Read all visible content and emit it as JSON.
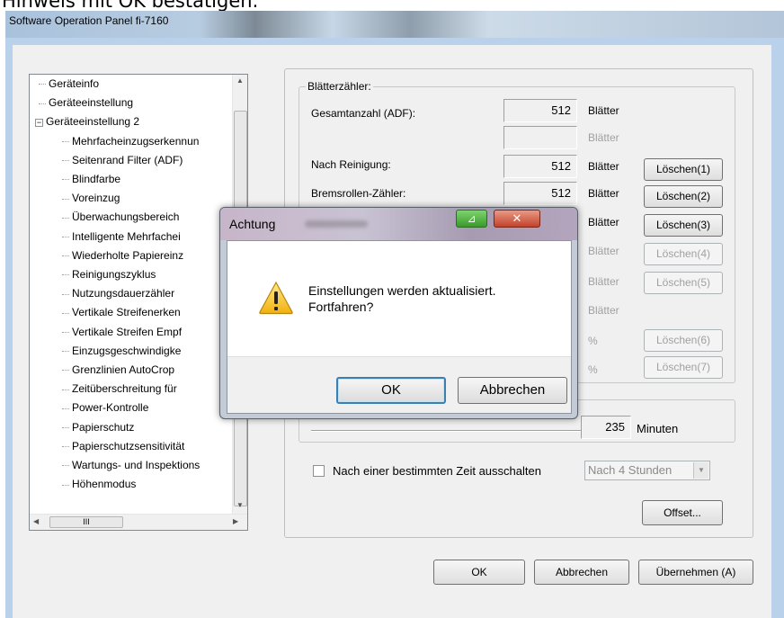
{
  "caption": "Hinweis mit OK bestätigen.",
  "window": {
    "title": "Software Operation Panel fi-7160"
  },
  "tree": {
    "items": [
      {
        "label": "Geräteinfo",
        "level": 1
      },
      {
        "label": "Geräteeinstellung",
        "level": 1
      },
      {
        "label": "Geräteeinstellung 2",
        "level": 0
      },
      {
        "label": "Mehrfacheinzugserkennun",
        "level": 2
      },
      {
        "label": "Seitenrand Filter (ADF)",
        "level": 2
      },
      {
        "label": "Blindfarbe",
        "level": 2
      },
      {
        "label": "Voreinzug",
        "level": 2
      },
      {
        "label": "Überwachungsbereich",
        "level": 2
      },
      {
        "label": "Intelligente Mehrfachei",
        "level": 2
      },
      {
        "label": "Wiederholte Papiereinz",
        "level": 2
      },
      {
        "label": "Reinigungszyklus",
        "level": 2
      },
      {
        "label": "Nutzungsdauerzähler",
        "level": 2
      },
      {
        "label": "Vertikale Streifenerken",
        "level": 2
      },
      {
        "label": "Vertikale Streifen Empf",
        "level": 2
      },
      {
        "label": "Einzugsgeschwindigke",
        "level": 2
      },
      {
        "label": "Grenzlinien AutoCrop",
        "level": 2
      },
      {
        "label": "Zeitüberschreitung für",
        "level": 2
      },
      {
        "label": "Power-Kontrolle",
        "level": 2
      },
      {
        "label": "Papierschutz",
        "level": 2
      },
      {
        "label": "Papierschutzsensitivität",
        "level": 2
      },
      {
        "label": "Wartungs- und Inspektions",
        "level": 2
      },
      {
        "label": "Höhenmodus",
        "level": 2
      }
    ],
    "expander": "−",
    "hscroll_grip": "III",
    "scroll_left": "◀",
    "scroll_right": "▶",
    "scroll_up": "▲",
    "scroll_down": "▼"
  },
  "counter": {
    "group_label": "Blätterzähler:",
    "rows": [
      {
        "label": "Gesamtanzahl (ADF):",
        "value": "512",
        "unit": "Blätter",
        "button": "",
        "enabled": true
      },
      {
        "label": "",
        "value": "",
        "unit": "Blätter",
        "button": "",
        "enabled": false
      },
      {
        "label": "Nach Reinigung:",
        "value": "512",
        "unit": "Blätter",
        "button": "Löschen(1)",
        "enabled": true
      },
      {
        "label": "Bremsrollen-Zähler:",
        "value": "512",
        "unit": "Blätter",
        "button": "Löschen(2)",
        "enabled": true
      },
      {
        "label": "",
        "value": "",
        "unit": "Blätter",
        "button": "Löschen(3)",
        "enabled": true
      },
      {
        "label": "",
        "value": "",
        "unit": "Blätter",
        "button": "Löschen(4)",
        "enabled": false
      },
      {
        "label": "",
        "value": "",
        "unit": "Blätter",
        "button": "Löschen(5)",
        "enabled": false
      },
      {
        "label": "",
        "value": "",
        "unit": "Blätter",
        "button": "",
        "enabled": false
      },
      {
        "label": "",
        "value": "",
        "unit": "%",
        "button": "Löschen(6)",
        "enabled": false
      },
      {
        "label": "",
        "value": "",
        "unit": "%",
        "button": "Löschen(7)",
        "enabled": false
      }
    ]
  },
  "power": {
    "minutes_value": "235",
    "minutes_unit": "Minuten",
    "checkbox_label": "Nach einer bestimmten Zeit ausschalten",
    "checked": false,
    "combo_value": "Nach 4 Stunden",
    "offset_button": "Offset..."
  },
  "footer": {
    "ok": "OK",
    "cancel": "Abbrechen",
    "apply": "Übernehmen (A)"
  },
  "dialog": {
    "title": "Achtung",
    "minimize_glyph": "⊿",
    "close_glyph": "✕",
    "message_line1": "Einstellungen werden aktualisiert.",
    "message_line2": "Fortfahren?",
    "ok": "OK",
    "cancel": "Abbrechen",
    "icon": "warning-icon"
  }
}
